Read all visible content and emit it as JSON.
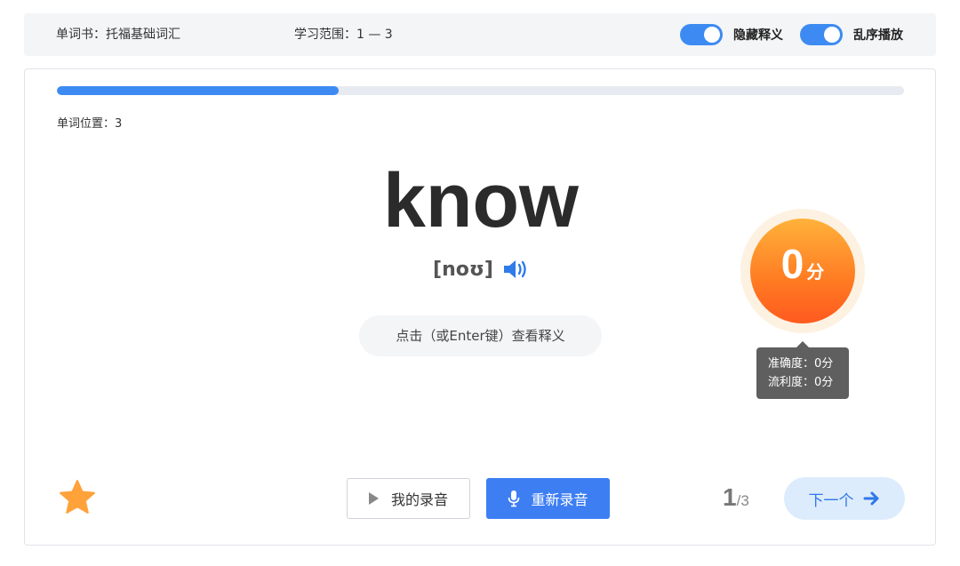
{
  "topbar": {
    "book_label": "单词书：托福基础词汇",
    "range_label": "学习范围：1 — 3",
    "toggles": [
      {
        "label": "隐藏释义",
        "on": true
      },
      {
        "label": "乱序播放",
        "on": true
      }
    ]
  },
  "progress": {
    "fraction": 0.333
  },
  "word_position": "单词位置：3",
  "word": {
    "text": "know",
    "phonetic": "[noʊ]"
  },
  "reveal_hint": "点击（或Enter键）查看释义",
  "score": {
    "value": "0",
    "unit": "分",
    "accuracy": "准确度：0分",
    "fluency": "流利度：0分"
  },
  "buttons": {
    "my_recording": "我的录音",
    "re_record": "重新录音",
    "next": "下一个"
  },
  "pager": {
    "current": "1",
    "separator": "/",
    "total": "3"
  },
  "colors": {
    "accent": "#3d8bf2",
    "star": "#ffa23a",
    "score_gradient_top": "#ffb23b",
    "score_gradient_bottom": "#ff5a1f"
  },
  "icons": {
    "speaker": "speaker-icon",
    "play": "play-icon",
    "mic": "mic-icon",
    "arrow": "arrow-right-icon",
    "star": "star-icon"
  }
}
